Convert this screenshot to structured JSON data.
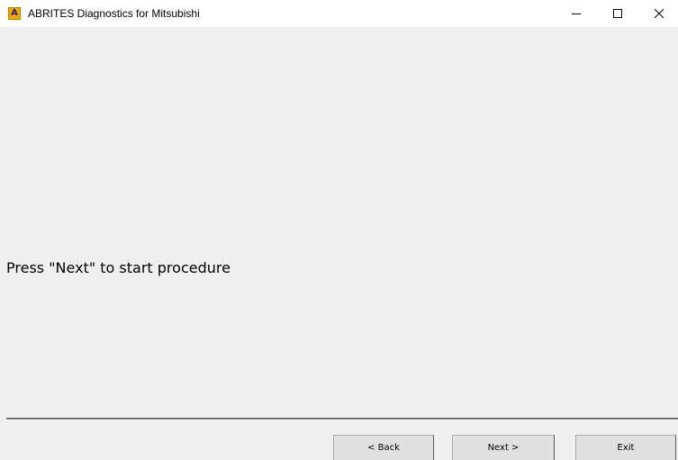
{
  "window": {
    "title": "ABRITES Diagnostics for Mitsubishi",
    "icon_letter": "A",
    "icon": "abrites-app-icon",
    "controls": {
      "minimize": "minimize-icon",
      "maximize": "maximize-icon",
      "close": "close-icon"
    }
  },
  "main": {
    "message": "Press \"Next\" to start procedure"
  },
  "footer": {
    "back_label": "< Back",
    "next_label": "Next >",
    "exit_label": "Exit"
  },
  "colors": {
    "background": "#f0f0f0",
    "titlebar": "#ffffff",
    "icon_accent": "#f5a800",
    "button_face": "#e1e1e1"
  }
}
